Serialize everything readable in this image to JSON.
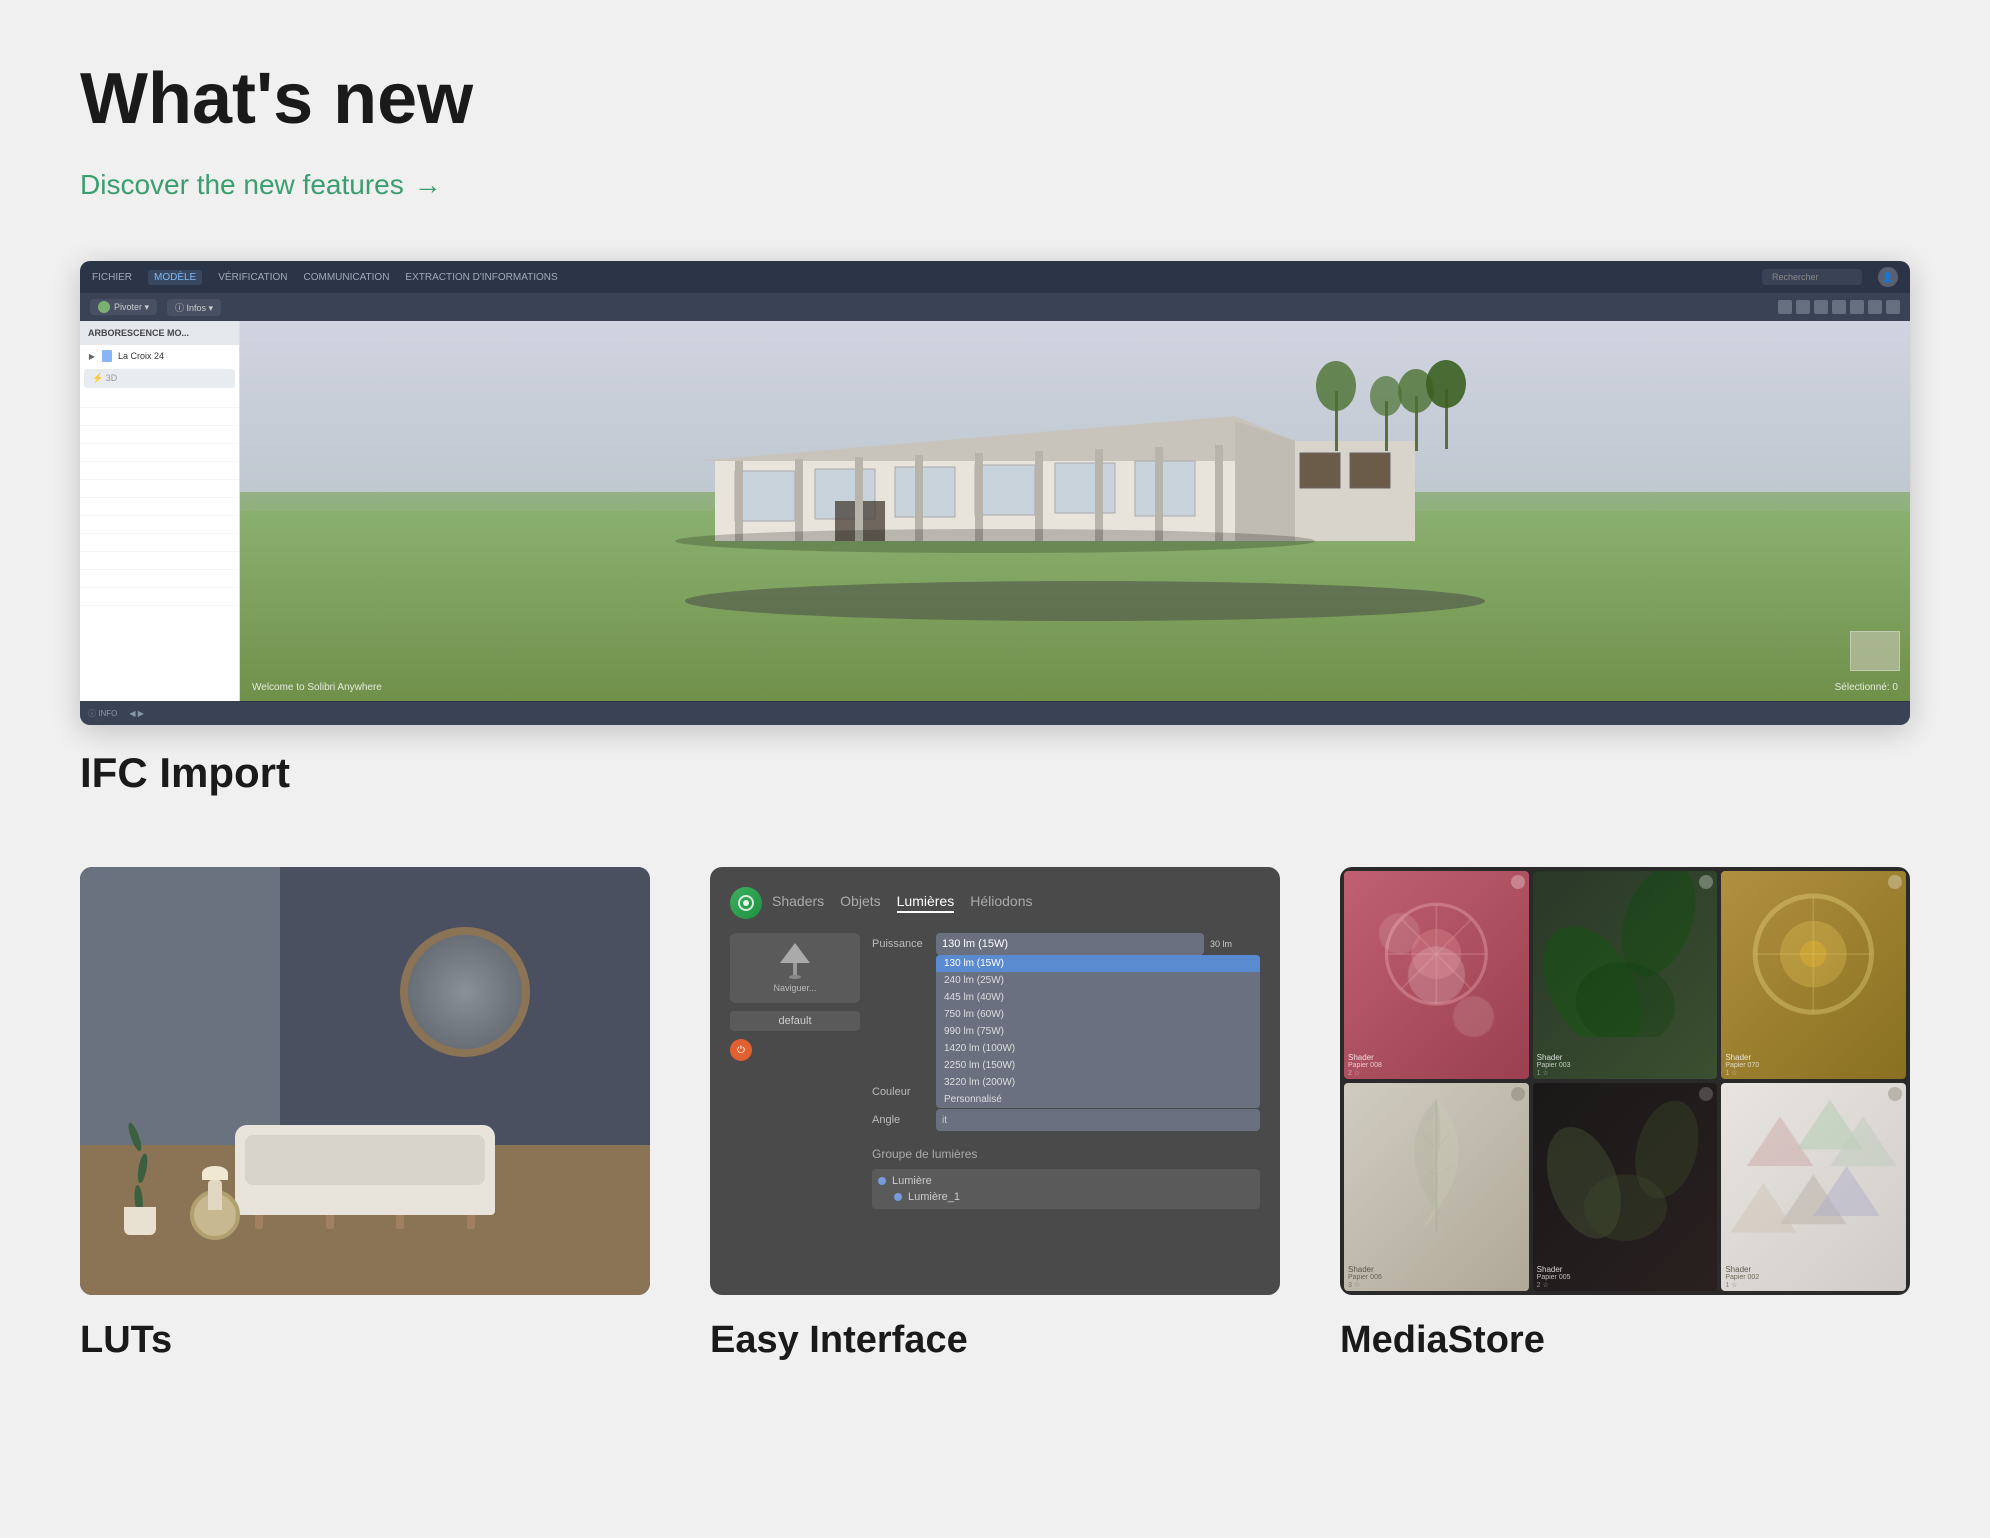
{
  "page": {
    "bg_color": "#f0f0f0",
    "title": "What's new"
  },
  "header": {
    "title": "What's new",
    "discover_link": "Discover the new features",
    "discover_arrow": "→"
  },
  "ifc_feature": {
    "title": "IFC Import",
    "app": {
      "menu_items": [
        "FICHIER",
        "MODÈLE",
        "VÉRIFICATION",
        "COMMUNICATION",
        "EXTRACTION D'INFORMATIONS"
      ],
      "active_menu": "MODÈLE",
      "search_placeholder": "Rechercher",
      "toolbar_buttons": [
        "Pivoter ▾",
        "Infos ▾"
      ],
      "tree_header": "ARBORESCENCE MO...",
      "tree_item": "La Croix 24",
      "view_label": "3D",
      "bottom_left": "INFO",
      "welcome_text": "Welcome to Solibri Anywhere",
      "selected_text": "Sélectionné: 0"
    }
  },
  "cards": [
    {
      "id": "luts",
      "title": "LUTs",
      "image_type": "room_photo"
    },
    {
      "id": "easy_interface",
      "title": "Easy Interface",
      "image_type": "ui_screenshot",
      "tabs": [
        "Shaders",
        "Objets",
        "Lumières",
        "Héliodons"
      ],
      "active_tab": "Lumières",
      "power_label": "Puissance",
      "color_label": "Couleur",
      "angle_label": "Angle",
      "dropdown_items": [
        "130 lm (15W)",
        "240 lm (25W)",
        "445 lm (40W)",
        "750 lm (60W)",
        "990 lm (75W)",
        "1420 lm (100W)",
        "2250 lm (150W)",
        "3220 lm (200W)",
        "Personnalisé"
      ],
      "active_dropdown": "130 lm (15W)",
      "group_label": "Groupe de lumières",
      "tree_items": [
        "Lumière",
        "Lumière_1"
      ],
      "default_label": "default"
    },
    {
      "id": "mediastore",
      "title": "MediaStore",
      "image_type": "media_grid",
      "tiles": [
        {
          "id": 1,
          "label": "Shader",
          "name": "Papier 008",
          "count": "2"
        },
        {
          "id": 2,
          "label": "Shader",
          "name": "Papier 003",
          "count": "1"
        },
        {
          "id": 3,
          "label": "Shader",
          "name": "Papier 070",
          "count": "1"
        },
        {
          "id": 4,
          "label": "Shader",
          "name": "Papier 006",
          "count": "3"
        },
        {
          "id": 5,
          "label": "Shader",
          "name": "Papier 005",
          "count": "2"
        },
        {
          "id": 6,
          "label": "Shader",
          "name": "Papier 002",
          "count": "1"
        }
      ]
    }
  ]
}
